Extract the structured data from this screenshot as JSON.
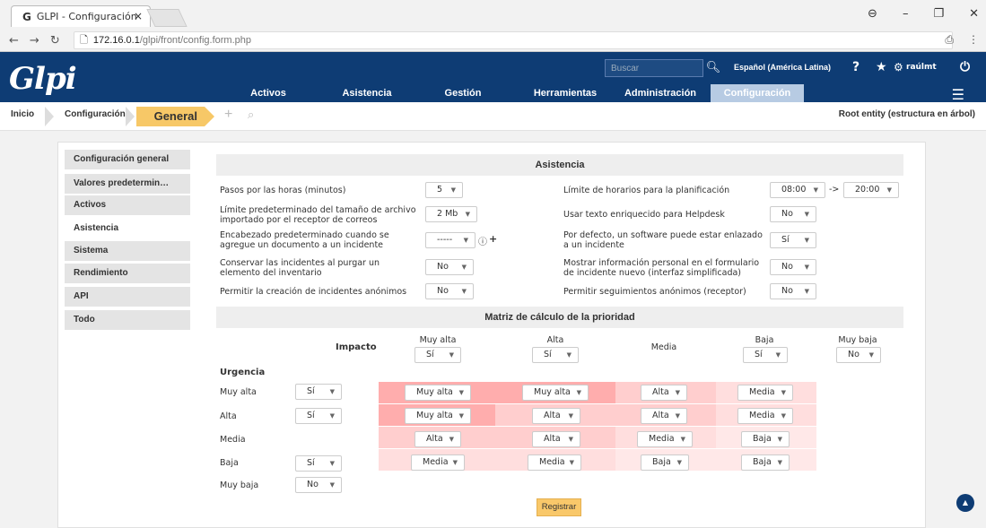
{
  "browser": {
    "tab_title": "GLPI - Configuración",
    "tab_close": "×",
    "url_host": "172.16.0.1",
    "url_path": "/glpi/front/config.form.php"
  },
  "header": {
    "logo": "Glpi",
    "search_placeholder": "Buscar",
    "language": "Español (América Latina)",
    "user": "raúlmt",
    "menu": [
      "Activos",
      "Asistencia",
      "Gestión",
      "Herramientas",
      "Administración",
      "Configuración"
    ]
  },
  "breadcrumb": {
    "home": "Inicio",
    "parent": "Configuración",
    "current": "General",
    "entity": "Root entity (estructura en árbol)"
  },
  "sidebar": [
    "Configuración general",
    "Valores predetermin…",
    "Activos",
    "Asistencia",
    "Sistema",
    "Rendimiento",
    "API",
    "Todo"
  ],
  "asistencia": {
    "title": "Asistencia",
    "left": [
      {
        "label": "Pasos por las horas (minutos)",
        "value": "5"
      },
      {
        "label": "Límite predeterminado del tamaño de archivo importado por el receptor de correos",
        "value": "2 Mb"
      },
      {
        "label": "Encabezado predeterminado cuando se agregue un documento a un incidente",
        "value": "-----"
      },
      {
        "label": "Conservar las incidentes al purgar un elemento del inventario",
        "value": "No"
      },
      {
        "label": "Permitir la creación de incidentes anónimos",
        "value": "No"
      }
    ],
    "right": [
      {
        "label": "Límite de horarios para la planificación",
        "value": "08:00",
        "value2": "20:00",
        "sep": "->"
      },
      {
        "label": "Usar texto enriquecido para Helpdesk",
        "value": "No"
      },
      {
        "label": "Por defecto, un software puede estar enlazado a un incidente",
        "value": "Sí"
      },
      {
        "label": "Mostrar información personal en el formulario de incidente nuevo (interfaz simplificada)",
        "value": "No"
      },
      {
        "label": "Permitir seguimientos anónimos (receptor)",
        "value": "No"
      }
    ],
    "info_icon": "ⓘ",
    "plus_icon": "+"
  },
  "matriz": {
    "title": "Matriz de cálculo de la prioridad",
    "impacto_label": "Impacto",
    "urgencia_label": "Urgencia",
    "impact_cols": [
      {
        "name": "Muy alta",
        "enabled": "Sí"
      },
      {
        "name": "Alta",
        "enabled": "Sí"
      },
      {
        "name": "Media",
        "enabled": ""
      },
      {
        "name": "Baja",
        "enabled": "Sí"
      },
      {
        "name": "Muy baja",
        "enabled": "No"
      }
    ],
    "rows": [
      {
        "name": "Muy alta",
        "enabled": "Sí",
        "cells": [
          "Muy alta",
          "Muy alta",
          "Alta",
          "Media"
        ]
      },
      {
        "name": "Alta",
        "enabled": "Sí",
        "cells": [
          "Muy alta",
          "Alta",
          "Alta",
          "Media"
        ]
      },
      {
        "name": "Media",
        "enabled": "",
        "cells": [
          "Alta",
          "Alta",
          "Media",
          "Baja"
        ]
      },
      {
        "name": "Baja",
        "enabled": "Sí",
        "cells": [
          "Media",
          "Media",
          "Baja",
          "Baja"
        ]
      },
      {
        "name": "Muy baja",
        "enabled": "No",
        "cells": []
      }
    ],
    "colors": {
      "Muy alta": "#ffadad",
      "Alta": "#ffcece",
      "Media": "#ffdede",
      "Baja": "#ffe8e8"
    }
  },
  "submit_label": "Registrar"
}
